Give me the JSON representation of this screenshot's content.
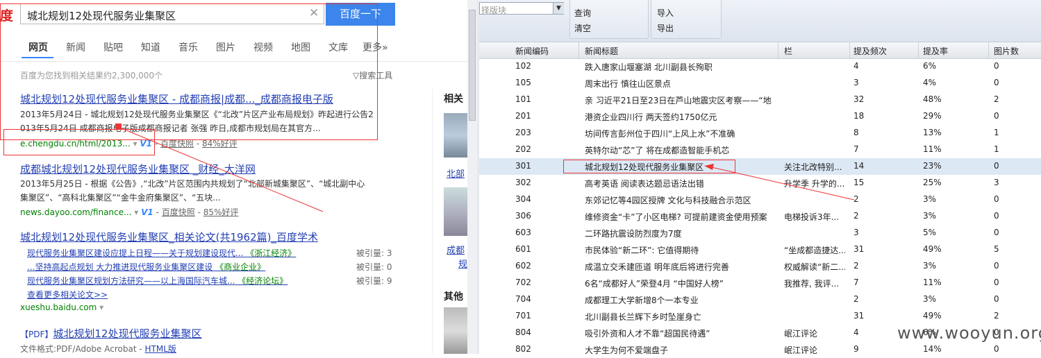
{
  "baidu": {
    "logo": "度",
    "query": "城北规划12处现代服务业集聚区",
    "search_button": "百度一下",
    "tabs": [
      "网页",
      "新闻",
      "贴吧",
      "知道",
      "音乐",
      "图片",
      "视频",
      "地图",
      "文库",
      "更多»"
    ],
    "result_count": "百度为您找到相关结果约2,300,000个",
    "search_tools": "搜索工具",
    "results": [
      {
        "title": "城北规划12处现代服务业集聚区 - 成都商报|成都..._成都商报电子版",
        "snippet_1": "2013年5月24日 - 城北规划12处现代服务业集聚区《“北改”片区产业布局规划》昨起进行公告2",
        "snippet_2": "013年5月24日 成都商报电子版成都商报记者 张强 昨日,成都市规划局在其官方...",
        "url": "e.chengdu.cn/html/2013...",
        "v": "V1",
        "snapshot": "百度快照",
        "rating": "84%好评"
      },
      {
        "title": "成都城北规划12处现代服务业集聚区 _财经_大洋网",
        "snippet_1": "2013年5月25日 -    根据《公告》,“北改”片区范围内共规划了“北部新城集聚区”、“城北副中心",
        "snippet_2": "集聚区”、“高科北集聚区”“金牛金府集聚区”、“五块...",
        "url": "news.dayoo.com/finance...",
        "v": "V1",
        "snapshot": "百度快照",
        "rating": "85%好评"
      },
      {
        "title": "城北规划12处现代服务业集聚区_相关论文(共1962篇)_百度学术",
        "papers": [
          {
            "title": "现代服务业集聚区建设应提上日程——关于规划建设现代...",
            "source": "《浙江经济》",
            "cite": "被引量: 3"
          },
          {
            "title": "...坚持高起点规划 大力推进现代服务业集聚区建设",
            "source": "《商业企业》",
            "cite": "被引量: 0"
          },
          {
            "title": "现代服务业集聚区规划方法研究——以上海国际汽车城...",
            "source": "《经济论坛》",
            "cite": "被引量: 9"
          }
        ],
        "more": "查看更多相关论文>>",
        "url": "xueshu.baidu.com"
      },
      {
        "pdf_tag": "【PDF】",
        "title": "城北规划12处现代服务业集聚区",
        "format": "文件格式:PDF/Adobe Acrobat - ",
        "html_link": "HTML版"
      }
    ],
    "related_heading": "相关",
    "related_link_1": "北部",
    "related_link_2": "成都",
    "related_link_2b": "规",
    "other_heading": "其他"
  },
  "app": {
    "block_select_placeholder": "择版块",
    "buttons": {
      "query": "查询",
      "clear": "清空",
      "import": "导入",
      "export": "导出"
    },
    "columns": [
      "新闻编码",
      "新闻标题",
      "栏",
      "提及频次",
      "提及率",
      "图片数"
    ],
    "rows": [
      {
        "code": "102",
        "title": "跌入唐家山堰塞湖 北川副县长殉职",
        "col": "",
        "freq": "4",
        "rate": "6%",
        "pics": "0"
      },
      {
        "code": "105",
        "title": "周末出行 慎往山区景点",
        "col": "",
        "freq": "3",
        "rate": "4%",
        "pics": "0"
      },
      {
        "code": "101",
        "title": "亲 习近平21日至23日在芦山地震灾区考察——“地...",
        "col": "",
        "freq": "32",
        "rate": "48%",
        "pics": "2"
      },
      {
        "code": "201",
        "title": "港资企业四川行 两天签约1750亿元",
        "col": "",
        "freq": "18",
        "rate": "29%",
        "pics": "0"
      },
      {
        "code": "203",
        "title": "坊间传言彭州位于四川“上风上水”不准确",
        "col": "",
        "freq": "8",
        "rate": "13%",
        "pics": "1"
      },
      {
        "code": "202",
        "title": "英特尔动“芯”了 将在成都造智能手机芯",
        "col": "",
        "freq": "7",
        "rate": "11%",
        "pics": "1"
      },
      {
        "code": "301",
        "title": "城北规划12处现代服务业集聚区",
        "col": "关注北改特别...",
        "freq": "14",
        "rate": "23%",
        "pics": "0",
        "selected": true
      },
      {
        "code": "302",
        "title": "高考英语 阅读表达题忌语法出错",
        "col": "升学季 升学的...",
        "freq": "15",
        "rate": "25%",
        "pics": "3"
      },
      {
        "code": "304",
        "title": "东郊记忆等4园区授牌 文化与科技融合示范区",
        "col": "",
        "freq": "2",
        "rate": "3%",
        "pics": "0"
      },
      {
        "code": "306",
        "title": "维修资金“卡”了小区电梯? 可提前建资金使用预案",
        "col": "电梯投诉3年...",
        "freq": "2",
        "rate": "3%",
        "pics": "0"
      },
      {
        "code": "603",
        "title": "二环路抗震设防烈度为7度",
        "col": "",
        "freq": "3",
        "rate": "5%",
        "pics": "0"
      },
      {
        "code": "601",
        "title": "市民体验“新二环”: 它值得期待",
        "col": "“坐成都造捷达...",
        "freq": "31",
        "rate": "49%",
        "pics": "5"
      },
      {
        "code": "602",
        "title": "成温立交禾建匝道 明年底后将进行完善",
        "col": "权威解读“新二...",
        "freq": "2",
        "rate": "3%",
        "pics": "0"
      },
      {
        "code": "702",
        "title": "6名“成都好人”荣登4月 “中国好人榜”",
        "col": "我推荐, 我评...",
        "freq": "7",
        "rate": "11%",
        "pics": "0"
      },
      {
        "code": "704",
        "title": "成都理工大学新增8个一本专业",
        "col": "",
        "freq": "2",
        "rate": "3%",
        "pics": "0"
      },
      {
        "code": "701",
        "title": "北川副县长兰辉下乡时坠崖身亡",
        "col": "",
        "freq": "31",
        "rate": "49%",
        "pics": "2"
      },
      {
        "code": "804",
        "title": "吸引外资和人才不靠“超国民待遇”",
        "col": "岷江评论",
        "freq": "4",
        "rate": "6%",
        "pics": "0"
      },
      {
        "code": "802",
        "title": "大学生为何不爱端盘子",
        "col": "岷江评论",
        "freq": "9",
        "rate": "14%",
        "pics": "0"
      }
    ]
  },
  "watermark": "www.wooyun.org",
  "colors": {
    "accent_blue": "#3b85ec",
    "annotation_red": "#e33",
    "link": "#2440b3",
    "url_green": "#008000"
  }
}
